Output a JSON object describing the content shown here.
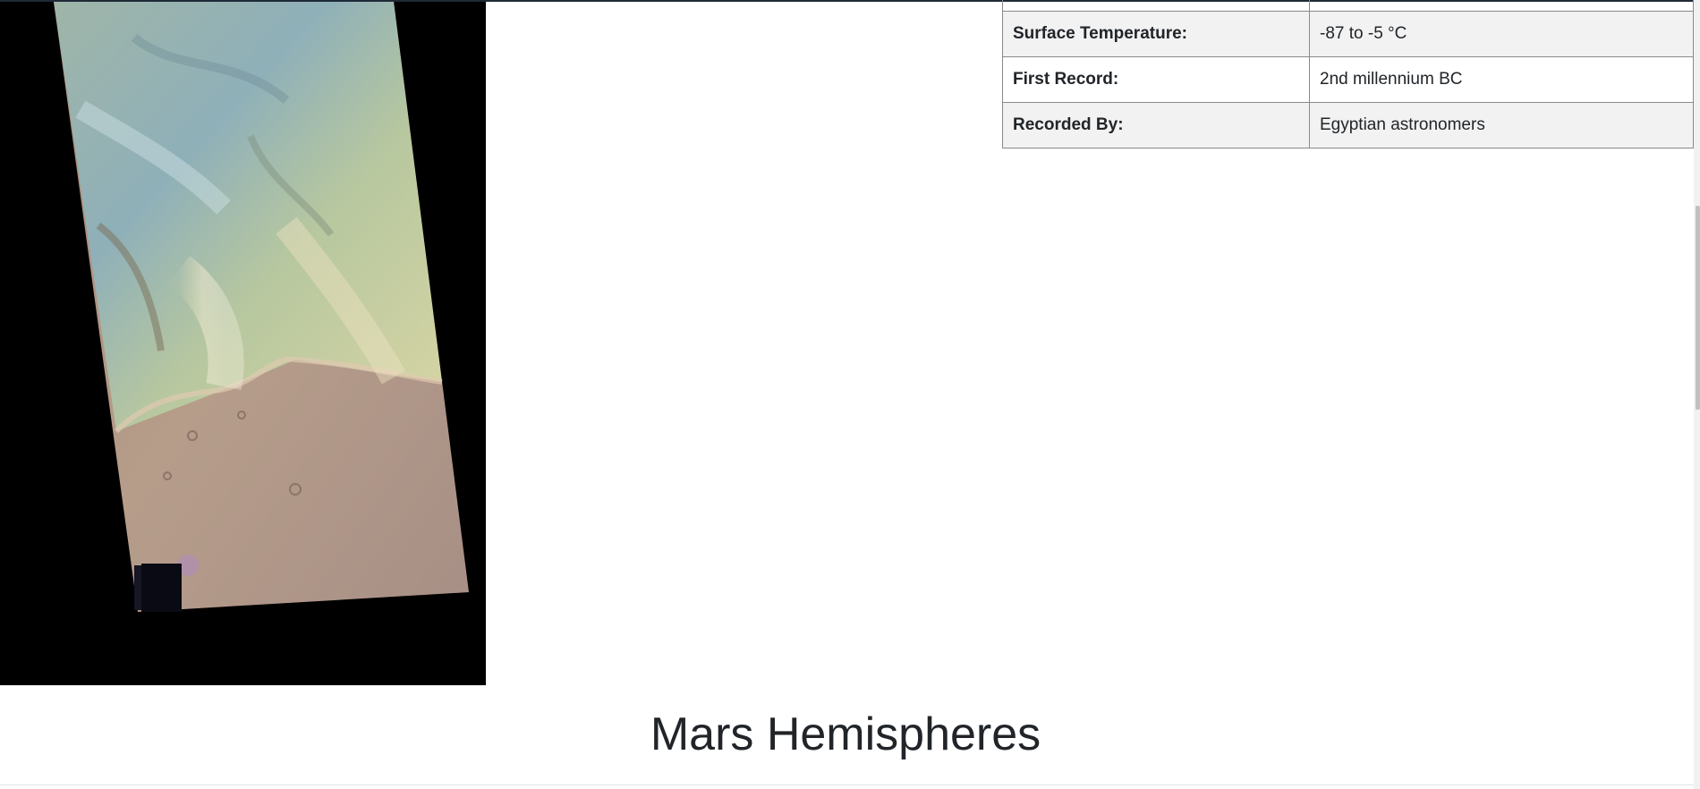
{
  "facts_table": {
    "rows": [
      {
        "label": "",
        "value": ""
      },
      {
        "label": "Surface Temperature:",
        "value": "-87 to -5 °C"
      },
      {
        "label": "First Record:",
        "value": "2nd millennium BC"
      },
      {
        "label": "Recorded By:",
        "value": "Egyptian astronomers"
      }
    ]
  },
  "hemispheres": {
    "heading": "Mars Hemispheres"
  }
}
